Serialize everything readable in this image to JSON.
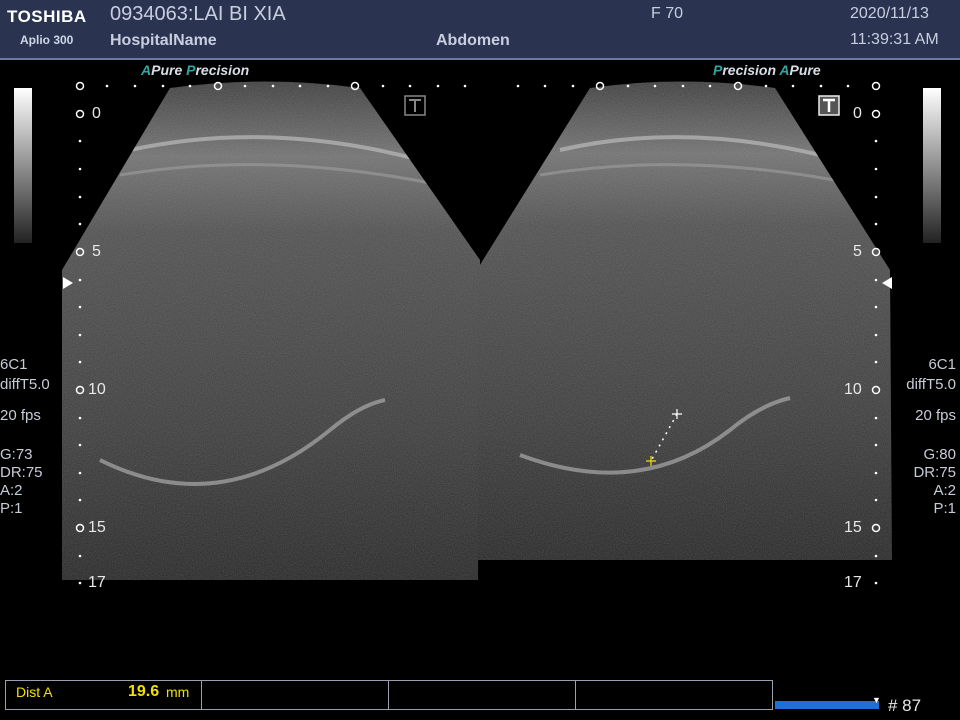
{
  "header": {
    "brand": "TOSHIBA",
    "model": "Aplio 300",
    "patient": "0934063:LAI BI XIA",
    "hospital": "HospitalName",
    "exam": "Abdomen",
    "frame_rate": "F  70",
    "date": "2020/11/13",
    "time": "11:39:31 AM"
  },
  "modes": {
    "left": {
      "a": "A",
      "pure": "Pure",
      "p": "P",
      "precision": "recision"
    },
    "right": {
      "p": "P",
      "precision": "recision",
      "a": "A",
      "pure": "Pure"
    }
  },
  "depth_labels": [
    "0",
    "5",
    "10",
    "15",
    "17"
  ],
  "left_params": {
    "probe": "6C1",
    "preset": "diffT5.0",
    "fps": "20 fps",
    "gain": "G:73",
    "dr": "DR:75",
    "a": "A:2",
    "p": "P:1"
  },
  "right_params": {
    "probe": "6C1",
    "preset": "diffT5.0",
    "fps": "20 fps",
    "gain": "G:80",
    "dr": "DR:75",
    "a": "A:2",
    "p": "P:1"
  },
  "measurement": {
    "label": "Dist A",
    "value": "19.6",
    "unit": "mm"
  },
  "cine": {
    "frame": "# 87",
    "progress": 0.97
  },
  "colors": {
    "header_bg": "#2a3450",
    "accent_teal": "#2fa7a2",
    "measure_yellow": "#f2e000",
    "progress_blue": "#1f6fd6"
  }
}
